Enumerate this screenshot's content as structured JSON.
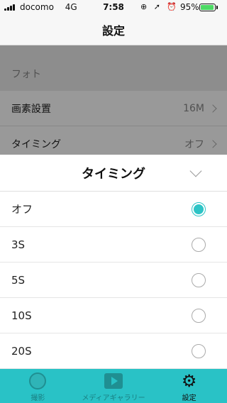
{
  "status_bar": {
    "carrier": "docomo",
    "network": "4G",
    "time": "7:58",
    "icons": "⊕ ➚ ⏰",
    "battery": "95%",
    "battery_level": 0.95
  },
  "nav": {
    "title": "設定"
  },
  "settings": {
    "section_photo": "フォト",
    "rows": [
      {
        "label": "画素設置",
        "value": "16M"
      },
      {
        "label": "タイミング",
        "value": "オフ"
      }
    ]
  },
  "sheet": {
    "title": "タイミング",
    "options": [
      {
        "label": "オフ",
        "selected": true
      },
      {
        "label": "3S",
        "selected": false
      },
      {
        "label": "5S",
        "selected": false
      },
      {
        "label": "10S",
        "selected": false
      },
      {
        "label": "20S",
        "selected": false
      }
    ]
  },
  "tabs": [
    {
      "label": "撮影",
      "icon": "camera-icon"
    },
    {
      "label": "メディアギャラリー",
      "icon": "media-play-icon"
    },
    {
      "label": "設定",
      "icon": "gear-icon",
      "active": true
    }
  ],
  "colors": {
    "accent": "#2ec4c6",
    "tab_bar": "#29c2c6"
  }
}
